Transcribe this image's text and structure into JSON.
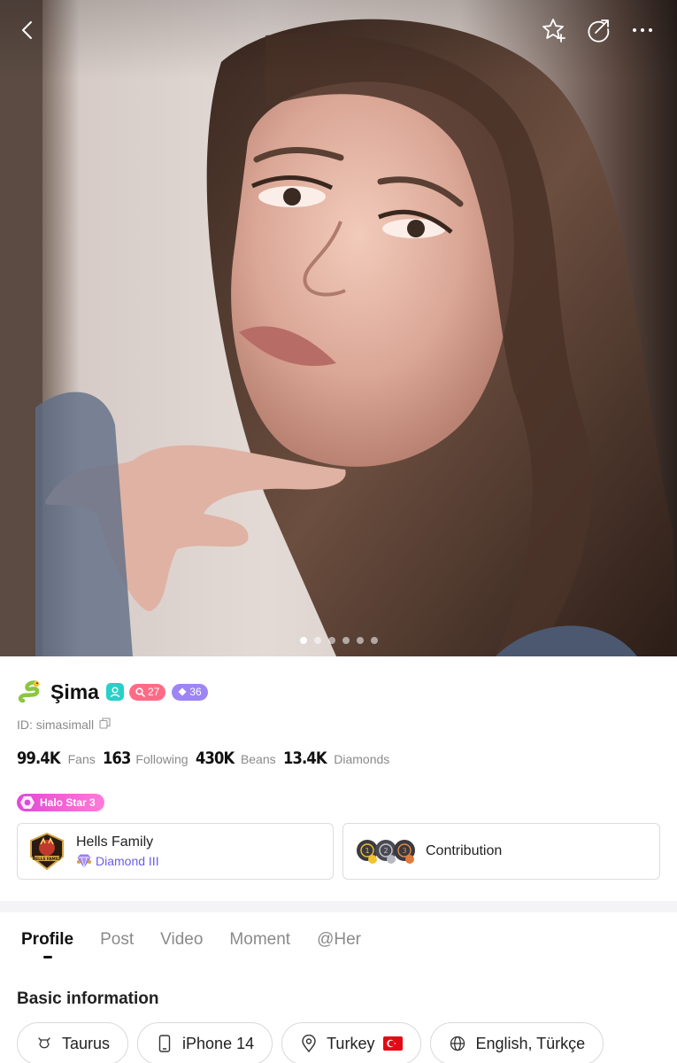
{
  "header": {
    "icons": {
      "back": "chevron-left-icon",
      "favorite": "star-plus-icon",
      "share": "share-edit-icon",
      "more": "more-dots-icon"
    },
    "photo_pager": {
      "count": 6,
      "active_index": 0
    }
  },
  "profile": {
    "zodiac_emoji": "🐍",
    "name": "Şima",
    "badges": [
      {
        "icon": "person-icon",
        "color": "#28d0c8"
      },
      {
        "value": "27",
        "icon": "search-icon",
        "color": "#ff6b86"
      },
      {
        "value": "36",
        "icon": "diamond-icon",
        "color": "#9d85f4"
      }
    ],
    "id_text": "ID: simasimall"
  },
  "stats": [
    {
      "value": "99.4K",
      "label": "Fans"
    },
    {
      "value": "163",
      "label": "Following"
    },
    {
      "value": "430K",
      "label": "Beans"
    },
    {
      "value": "13.4K",
      "label": "Diamonds"
    }
  ],
  "halo_badge": "Halo Star 3",
  "family": {
    "name": "Hells Family",
    "rank": "Diamond III",
    "logo_text": "HELLS FAMILY"
  },
  "contribution": {
    "label": "Contribution",
    "medals": [
      "1",
      "2",
      "3"
    ]
  },
  "tabs": [
    {
      "label": "Profile",
      "active": true
    },
    {
      "label": "Post",
      "active": false
    },
    {
      "label": "Video",
      "active": false
    },
    {
      "label": "Moment",
      "active": false
    },
    {
      "label": "@Her",
      "active": false
    }
  ],
  "basic_info": {
    "title": "Basic information",
    "tags": [
      {
        "label": "Taurus",
        "icon": "zodiac-icon"
      },
      {
        "label": "iPhone 14",
        "icon": "phone-icon"
      },
      {
        "label": "Turkey",
        "icon": "location-pin-icon",
        "flag": "turkey-flag"
      },
      {
        "label": "English, Türkçe",
        "icon": "globe-icon"
      }
    ]
  },
  "colors": {
    "accent_pink": "#ff6b86",
    "accent_purple": "#9d85f4",
    "accent_teal": "#28d0c8",
    "rank_text": "#6b5cf0"
  }
}
